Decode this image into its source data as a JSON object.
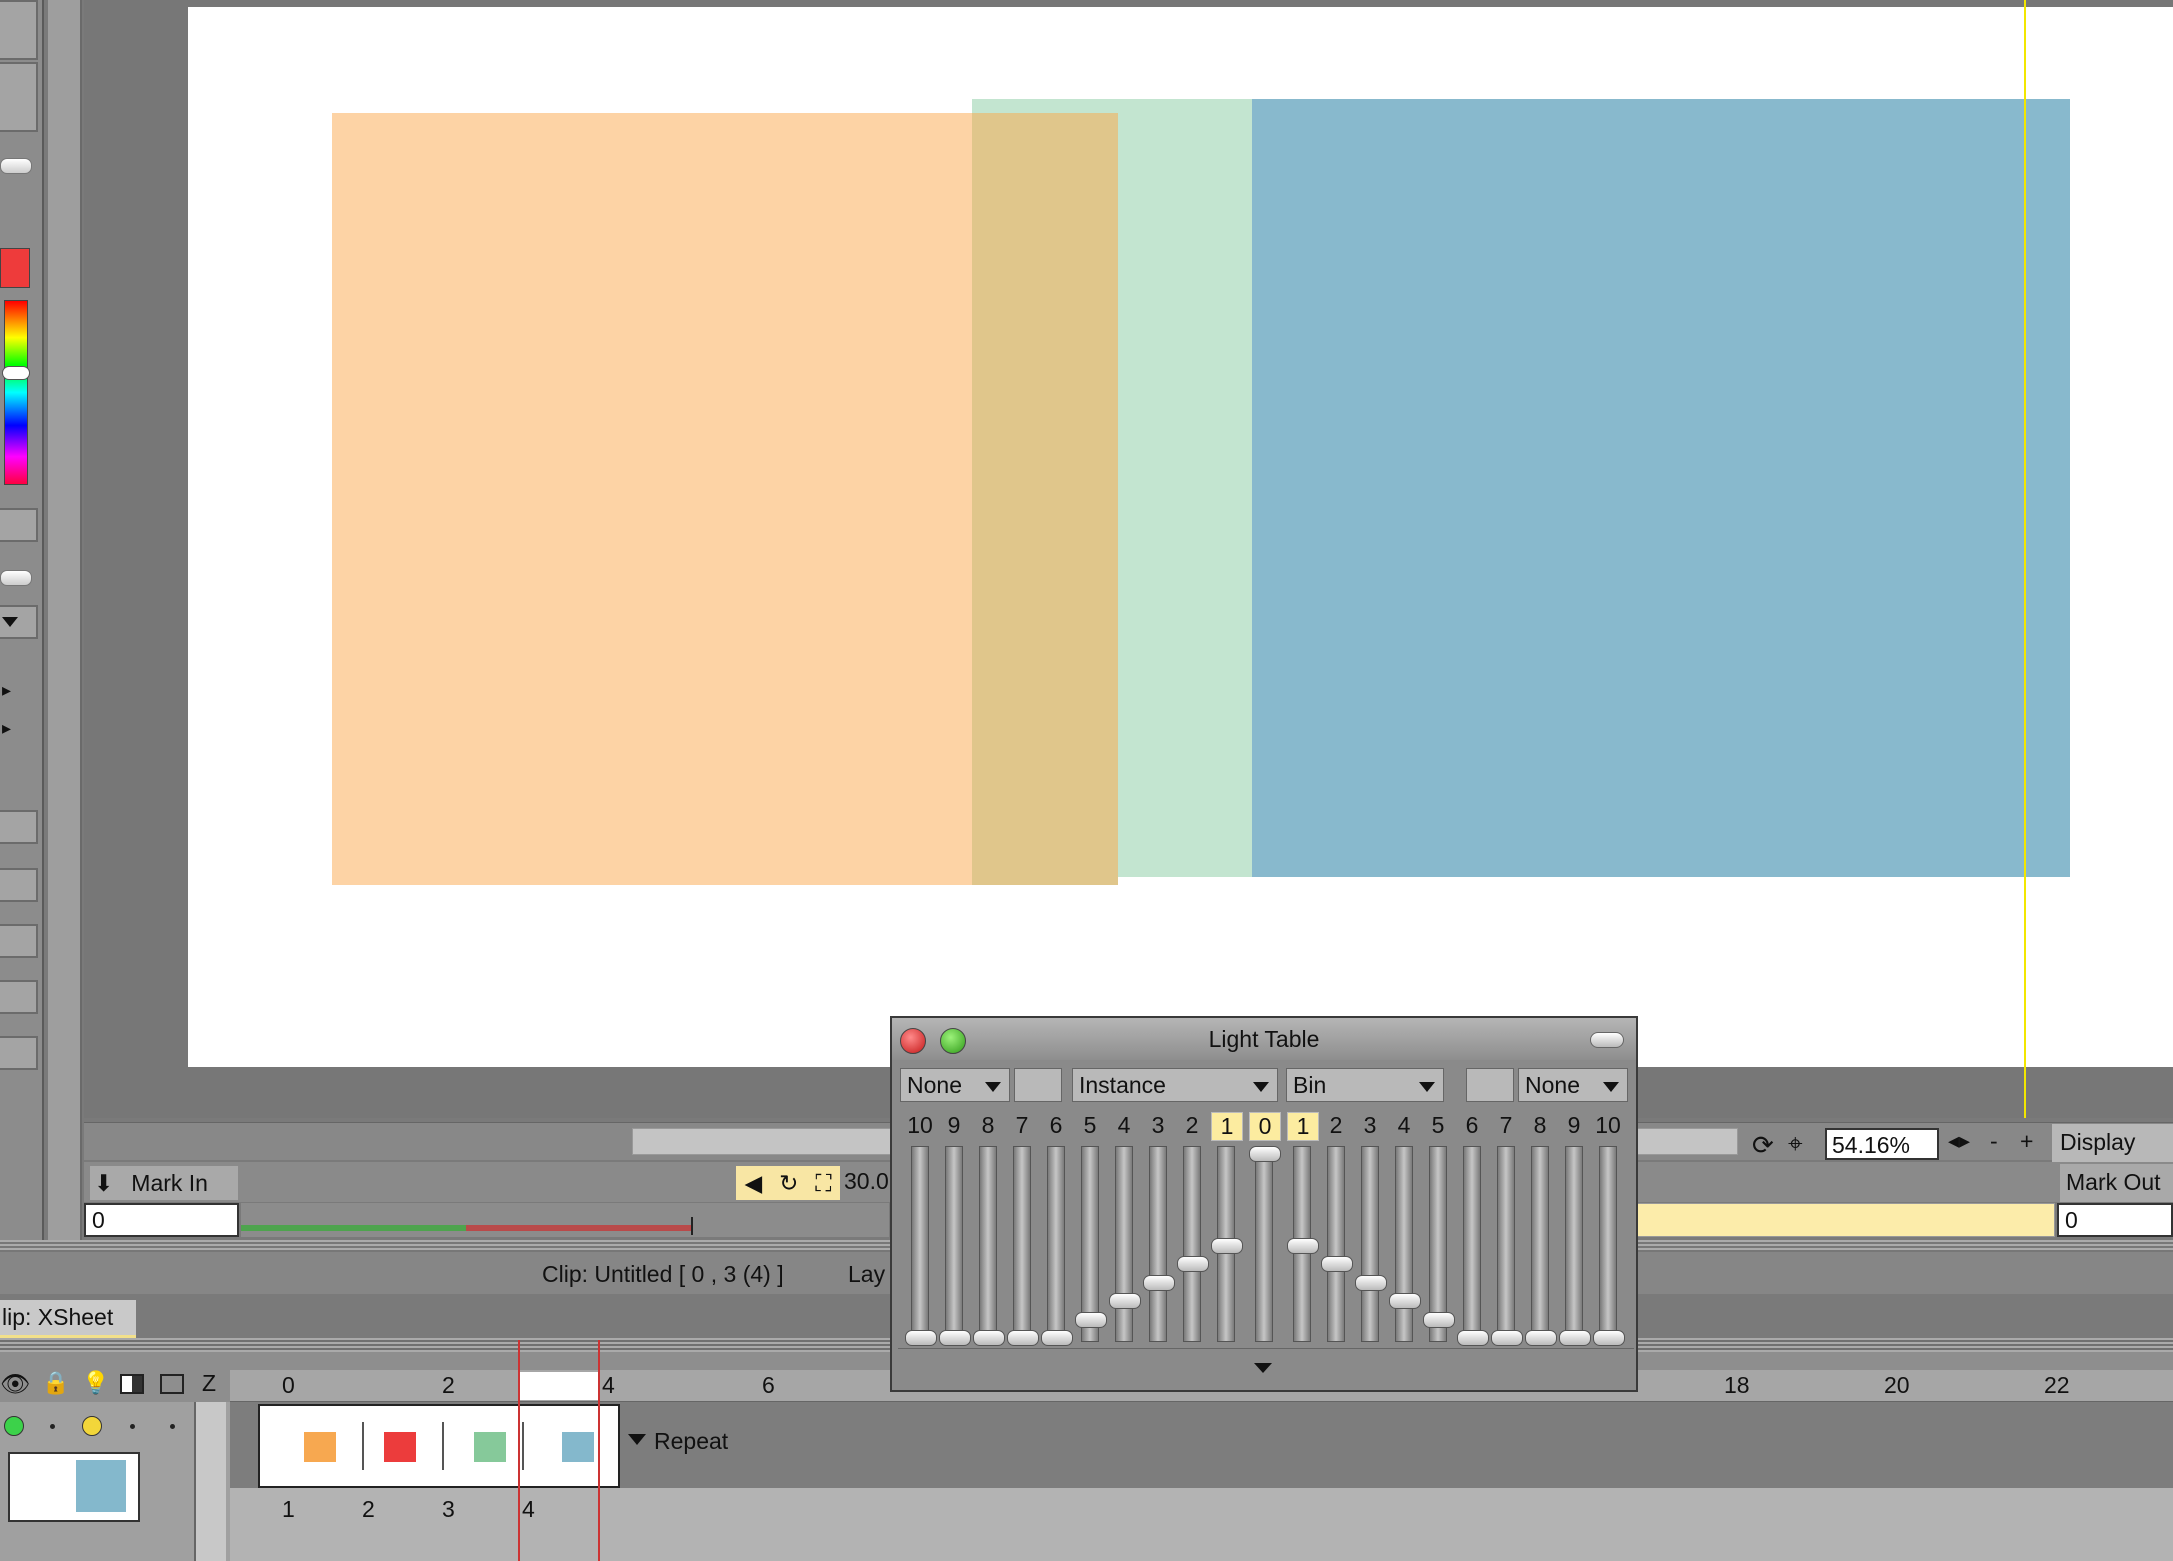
{
  "viewer": {
    "zoom": "54.16%",
    "display_label": "Display",
    "guide_color": "#f2e600",
    "fps_partial": "30.0"
  },
  "markers": {
    "mark_in_label": "Mark In",
    "mark_out_label": "Mark Out",
    "mark_in_value": "0",
    "mark_out_value": "0",
    "zoom_minus": "-",
    "zoom_plus": "+"
  },
  "status": {
    "clip_info": "Clip: Untitled [ 0 , 3  (4) ]",
    "layer_partial": "Lay"
  },
  "xsheet": {
    "tab_label": "lip: XSheet",
    "z_label": "Z",
    "repeat_label": "Repeat",
    "ruler_ticks": [
      "0",
      "2",
      "4",
      "6",
      "18",
      "20",
      "22"
    ],
    "frame_numbers": [
      "1",
      "2",
      "3",
      "4"
    ],
    "frame_colors": [
      "#f7a850",
      "#ec3c3c",
      "#86c99a",
      "#84b8cc"
    ]
  },
  "light_table": {
    "title": "Light Table",
    "dropdown_left": "None",
    "dropdown_mode": "Instance",
    "dropdown_source": "Bin",
    "dropdown_right": "None",
    "numbers_before": [
      "10",
      "9",
      "8",
      "7",
      "6",
      "5",
      "4",
      "3",
      "2",
      "1"
    ],
    "current": "0",
    "numbers_after": [
      "1",
      "2",
      "3",
      "4",
      "5",
      "6",
      "7",
      "8",
      "9",
      "10"
    ],
    "levels_before": [
      0,
      0,
      0,
      0,
      0,
      0.1,
      0.2,
      0.3,
      0.4,
      0.5
    ],
    "level_current": 1.0,
    "levels_after": [
      0.5,
      0.4,
      0.3,
      0.2,
      0.1,
      0,
      0,
      0,
      0,
      0
    ]
  },
  "canvas_colors": {
    "orange": "#fdd3a5",
    "green": "#c3e5d0",
    "blue": "#88b9cd",
    "overlap": "#e0c68b"
  }
}
